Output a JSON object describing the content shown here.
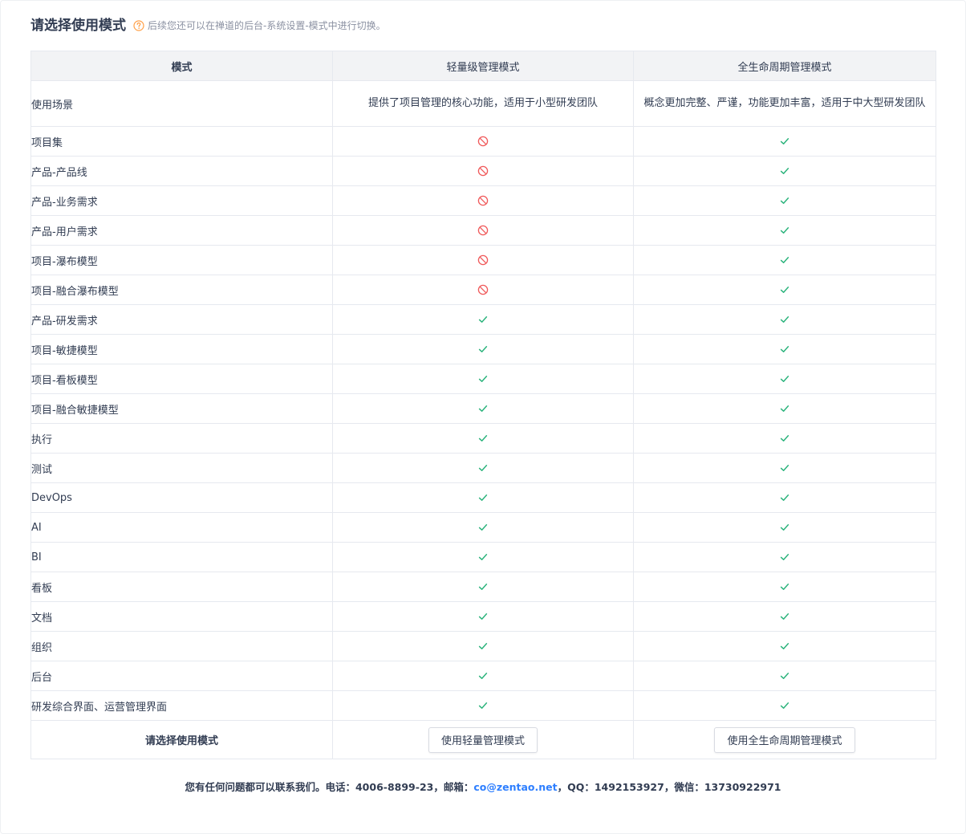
{
  "header": {
    "title": "请选择使用模式",
    "tip": "后续您还可以在禅道的后台-系统设置-模式中进行切换。"
  },
  "table": {
    "columns": [
      "模式",
      "轻量级管理模式",
      "全生命周期管理模式"
    ],
    "scene": {
      "label": "使用场景",
      "light": "提供了项目管理的核心功能，适用于小型研发团队",
      "full": "概念更加完整、严谨，功能更加丰富，适用于中大型研发团队"
    },
    "rows": [
      {
        "feature": "项目集",
        "light": "disabled",
        "full": "check"
      },
      {
        "feature": "产品-产品线",
        "light": "disabled",
        "full": "check"
      },
      {
        "feature": "产品-业务需求",
        "light": "disabled",
        "full": "check"
      },
      {
        "feature": "产品-用户需求",
        "light": "disabled",
        "full": "check"
      },
      {
        "feature": "项目-瀑布模型",
        "light": "disabled",
        "full": "check"
      },
      {
        "feature": "项目-融合瀑布模型",
        "light": "disabled",
        "full": "check"
      },
      {
        "feature": "产品-研发需求",
        "light": "check",
        "full": "check"
      },
      {
        "feature": "项目-敏捷模型",
        "light": "check",
        "full": "check"
      },
      {
        "feature": "项目-看板模型",
        "light": "check",
        "full": "check"
      },
      {
        "feature": "项目-融合敏捷模型",
        "light": "check",
        "full": "check"
      },
      {
        "feature": "执行",
        "light": "check",
        "full": "check"
      },
      {
        "feature": "测试",
        "light": "check",
        "full": "check"
      },
      {
        "feature": "DevOps",
        "light": "check",
        "full": "check"
      },
      {
        "feature": "AI",
        "light": "check",
        "full": "check"
      },
      {
        "feature": "BI",
        "light": "check",
        "full": "check"
      },
      {
        "feature": "看板",
        "light": "check",
        "full": "check"
      },
      {
        "feature": "文档",
        "light": "check",
        "full": "check"
      },
      {
        "feature": "组织",
        "light": "check",
        "full": "check"
      },
      {
        "feature": "后台",
        "light": "check",
        "full": "check"
      },
      {
        "feature": "研发综合界面、运营管理界面",
        "light": "check",
        "full": "check"
      }
    ],
    "footer": {
      "label": "请选择使用模式",
      "light_button": "使用轻量管理模式",
      "full_button": "使用全生命周期管理模式"
    }
  },
  "contact": {
    "prefix": "您有任何问题都可以联系我们。电话：4006-8899-23，邮箱：",
    "email": "co@zentao.net",
    "suffix": "，QQ：1492153927，微信：13730922971"
  },
  "icons": {
    "help": "question-circle-icon",
    "check": "check-icon",
    "disabled": "ban-icon"
  },
  "colors": {
    "check": "#2db47d",
    "disabled": "#f0595a",
    "help": "#ff9f46",
    "link": "#2e7fff"
  }
}
